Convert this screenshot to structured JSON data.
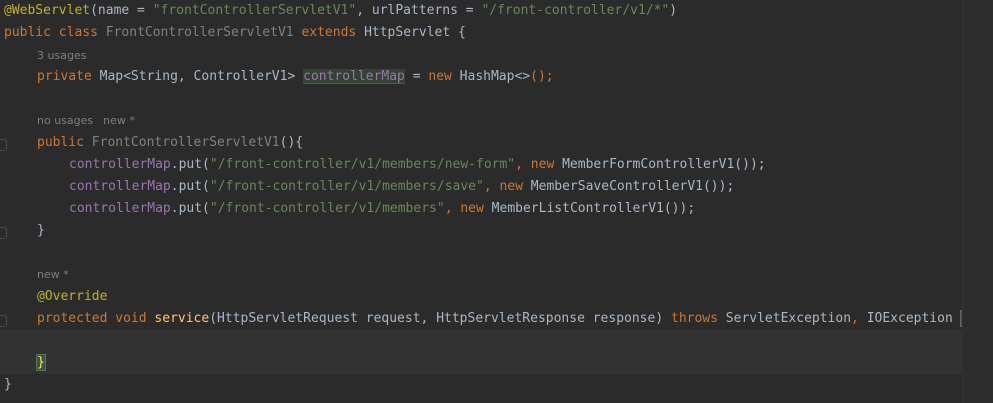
{
  "colors": {
    "background": "#2b2b2b",
    "keyword": "#cc7832",
    "string": "#6a8759",
    "annotation": "#bbb529",
    "field": "#9876aa",
    "method_decl": "#ffc66d",
    "plain": "#a9b7c6",
    "inlay_hint": "#7a7e85"
  },
  "code": {
    "line1": {
      "annotation": "@WebServlet",
      "open": "(name = ",
      "name_value": "\"frontControllerServletV1\"",
      "mid": ", urlPatterns = ",
      "url_value": "\"/front-controller/v1/*\"",
      "close": ")"
    },
    "line2": {
      "kw_public": "public",
      "kw_class": "class",
      "class_name": "FrontControllerServletV1",
      "kw_extends": "extends",
      "super_name": "HttpServlet",
      "brace": "{"
    },
    "hint_usages": "3 usages",
    "line3": {
      "kw_private": "private",
      "type": "Map<String, ControllerV1>",
      "field": "controllerMap",
      "assign": " = ",
      "kw_new": "new",
      "init": "HashMap<>",
      "end": "();"
    },
    "hint_no_usages": "no usages",
    "hint_new1": "new *",
    "line4": {
      "kw_public": "public",
      "ctor_name": "FrontControllerServletV1",
      "rest": "(){"
    },
    "puts": [
      {
        "field": "controllerMap",
        "call": ".put(",
        "path": "\"/front-controller/v1/members/new-form\"",
        "comma": ", ",
        "kw_new": "new",
        "ctor": "MemberFormControllerV1",
        "end": "());"
      },
      {
        "field": "controllerMap",
        "call": ".put(",
        "path": "\"/front-controller/v1/members/save\"",
        "comma": ", ",
        "kw_new": "new",
        "ctor": "MemberSaveControllerV1",
        "end": "());"
      },
      {
        "field": "controllerMap",
        "call": ".put(",
        "path": "\"/front-controller/v1/members\"",
        "comma": ", ",
        "kw_new": "new",
        "ctor": "MemberListControllerV1",
        "end": "());"
      }
    ],
    "ctor_close": "}",
    "hint_new2": "new *",
    "override": "@Override",
    "line_service": {
      "kw_protected": "protected",
      "kw_void": "void",
      "method": "service",
      "params": "(HttpServletRequest request, HttpServletResponse response)",
      "kw_throws": "throws",
      "exceptions_a": "ServletException",
      "exceptions_sep": ", ",
      "exceptions_b": "IOException",
      "brace": "{"
    },
    "service_close": "}",
    "class_close": "}"
  }
}
